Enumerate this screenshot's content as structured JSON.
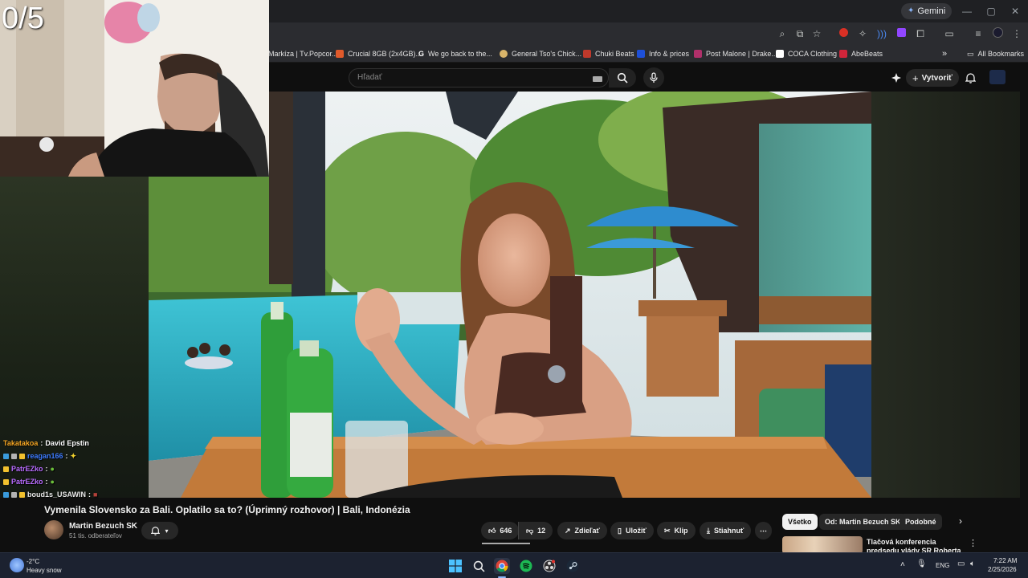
{
  "overlay": {
    "counter": "0/5"
  },
  "browser": {
    "gemini_label": "Gemini",
    "bookmarks": [
      {
        "label": "Markíza | Tv.Popcor...",
        "color": "#00000000"
      },
      {
        "label": "Crucial 8GB (2x4GB)...",
        "color": "#e05a2b"
      },
      {
        "label": "We go back to the...",
        "color": "#ffffff"
      },
      {
        "label": "General Tso's Chick...",
        "color": "#d8b46a"
      },
      {
        "label": "Chuki Beats",
        "color": "#c0392b"
      },
      {
        "label": "Info & prices",
        "color": "#1e50d8"
      },
      {
        "label": "Post Malone | Drake...",
        "color": "#b0306a"
      },
      {
        "label": "COCA Clothing",
        "color": "#ffffff"
      },
      {
        "label": "AbeBeats",
        "color": "#d0253a"
      }
    ],
    "all_bookmarks": "All Bookmarks",
    "more_bookmarks": "»"
  },
  "youtube": {
    "search_placeholder": "Hľadať",
    "create_label": "Vytvoriť",
    "video_title": "Vymenila Slovensko za Bali. Oplatilo sa to? (Úprimný rozhovor) | Bali, Indonézia",
    "channel": {
      "name": "Martin Bezuch SK",
      "subscribers": "51 tis. odberateľov"
    },
    "actions": {
      "likes": "646",
      "dislikes": "12",
      "share": "Zdieľať",
      "save": "Uložiť",
      "clip": "Klip",
      "download": "Stiahnuť"
    },
    "chips": [
      "Všetko",
      "Od: Martin Bezuch SK",
      "Podobné"
    ],
    "recommendation_title": "Tlačová konferencia predsedu vlády SR Roberta Fica po"
  },
  "chat": [
    {
      "user": "Takatakoa",
      "message": "David Epstin",
      "color": "#f5a623",
      "badges": []
    },
    {
      "user": "reagan166",
      "message": "",
      "color": "#3d7bff",
      "badges": [
        "#3a9bdc",
        "#b3b3b3",
        "#f2c12e"
      ]
    },
    {
      "user": "PatrEZko",
      "message": "",
      "color": "#b86bff",
      "badges": [
        "#f2c12e"
      ]
    },
    {
      "user": "PatrEZko",
      "message": "",
      "color": "#b86bff",
      "badges": [
        "#f2c12e"
      ]
    },
    {
      "user": "boud1s_USAWIN",
      "message": "",
      "color": "#e8e8e8",
      "badges": [
        "#3a9bdc",
        "#b3b3b3",
        "#f2c12e"
      ]
    }
  ],
  "taskbar": {
    "weather_temp": "-2°C",
    "weather_desc": "Heavy snow",
    "language": "ENG",
    "time": "7:22 AM",
    "date": "2/25/2026"
  }
}
